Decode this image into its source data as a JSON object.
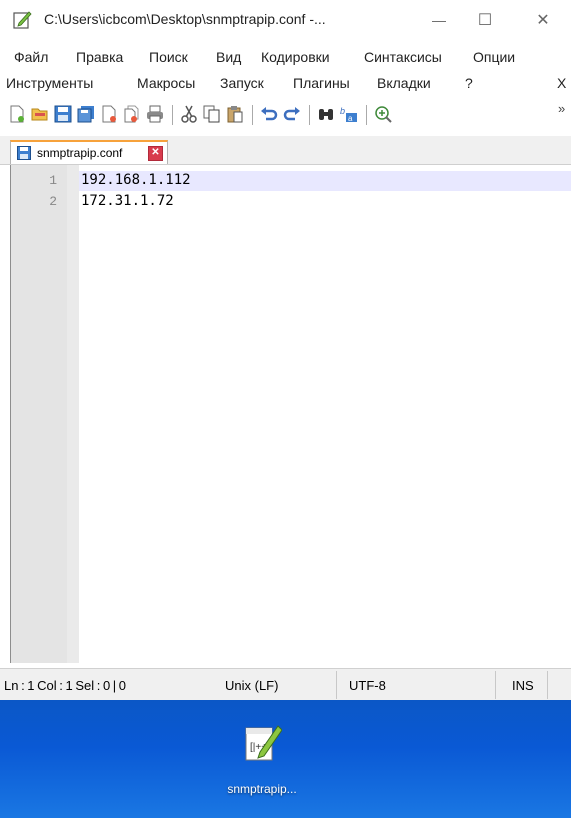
{
  "window": {
    "title": "C:\\Users\\icbcom\\Desktop\\snmptrapip.conf -...",
    "min_glyph": "—",
    "max_glyph": "☐",
    "close_glyph": "✕"
  },
  "menu": {
    "row1": [
      "Файл",
      "Правка",
      "Поиск",
      "Вид",
      "Кодировки",
      "Синтаксисы",
      "Опции"
    ],
    "row2": [
      "Инструменты",
      "Макросы",
      "Запуск",
      "Плагины",
      "Вкладки",
      "?"
    ],
    "close_x": "X"
  },
  "toolbar": {
    "icons": [
      "new-file-icon",
      "open-file-icon",
      "save-icon",
      "save-all-icon",
      "close-icon",
      "close-all-icon",
      "print-icon",
      "cut-icon",
      "copy-icon",
      "paste-icon",
      "undo-icon",
      "redo-icon",
      "find-icon",
      "replace-icon",
      "zoom-in-icon"
    ],
    "overflow": "»"
  },
  "tab": {
    "label": "snmptrapip.conf",
    "close_glyph": "✕"
  },
  "editor": {
    "lines": [
      {
        "number": "1",
        "text": "192.168.1.112"
      },
      {
        "number": "2",
        "text": "172.31.1.72"
      }
    ]
  },
  "statusbar": {
    "position": "Ln : 1    Col : 1    Sel : 0 | 0",
    "eol": "Unix (LF)",
    "encoding": "UTF-8",
    "mode": "INS"
  },
  "desktop": {
    "icon_label": "snmptrapip..."
  },
  "colors": {
    "tab_accent": "#f7a23b",
    "tab_close": "#d83b4d",
    "current_line": "#e8e8ff",
    "desktop_blue": "#0b57c6"
  }
}
